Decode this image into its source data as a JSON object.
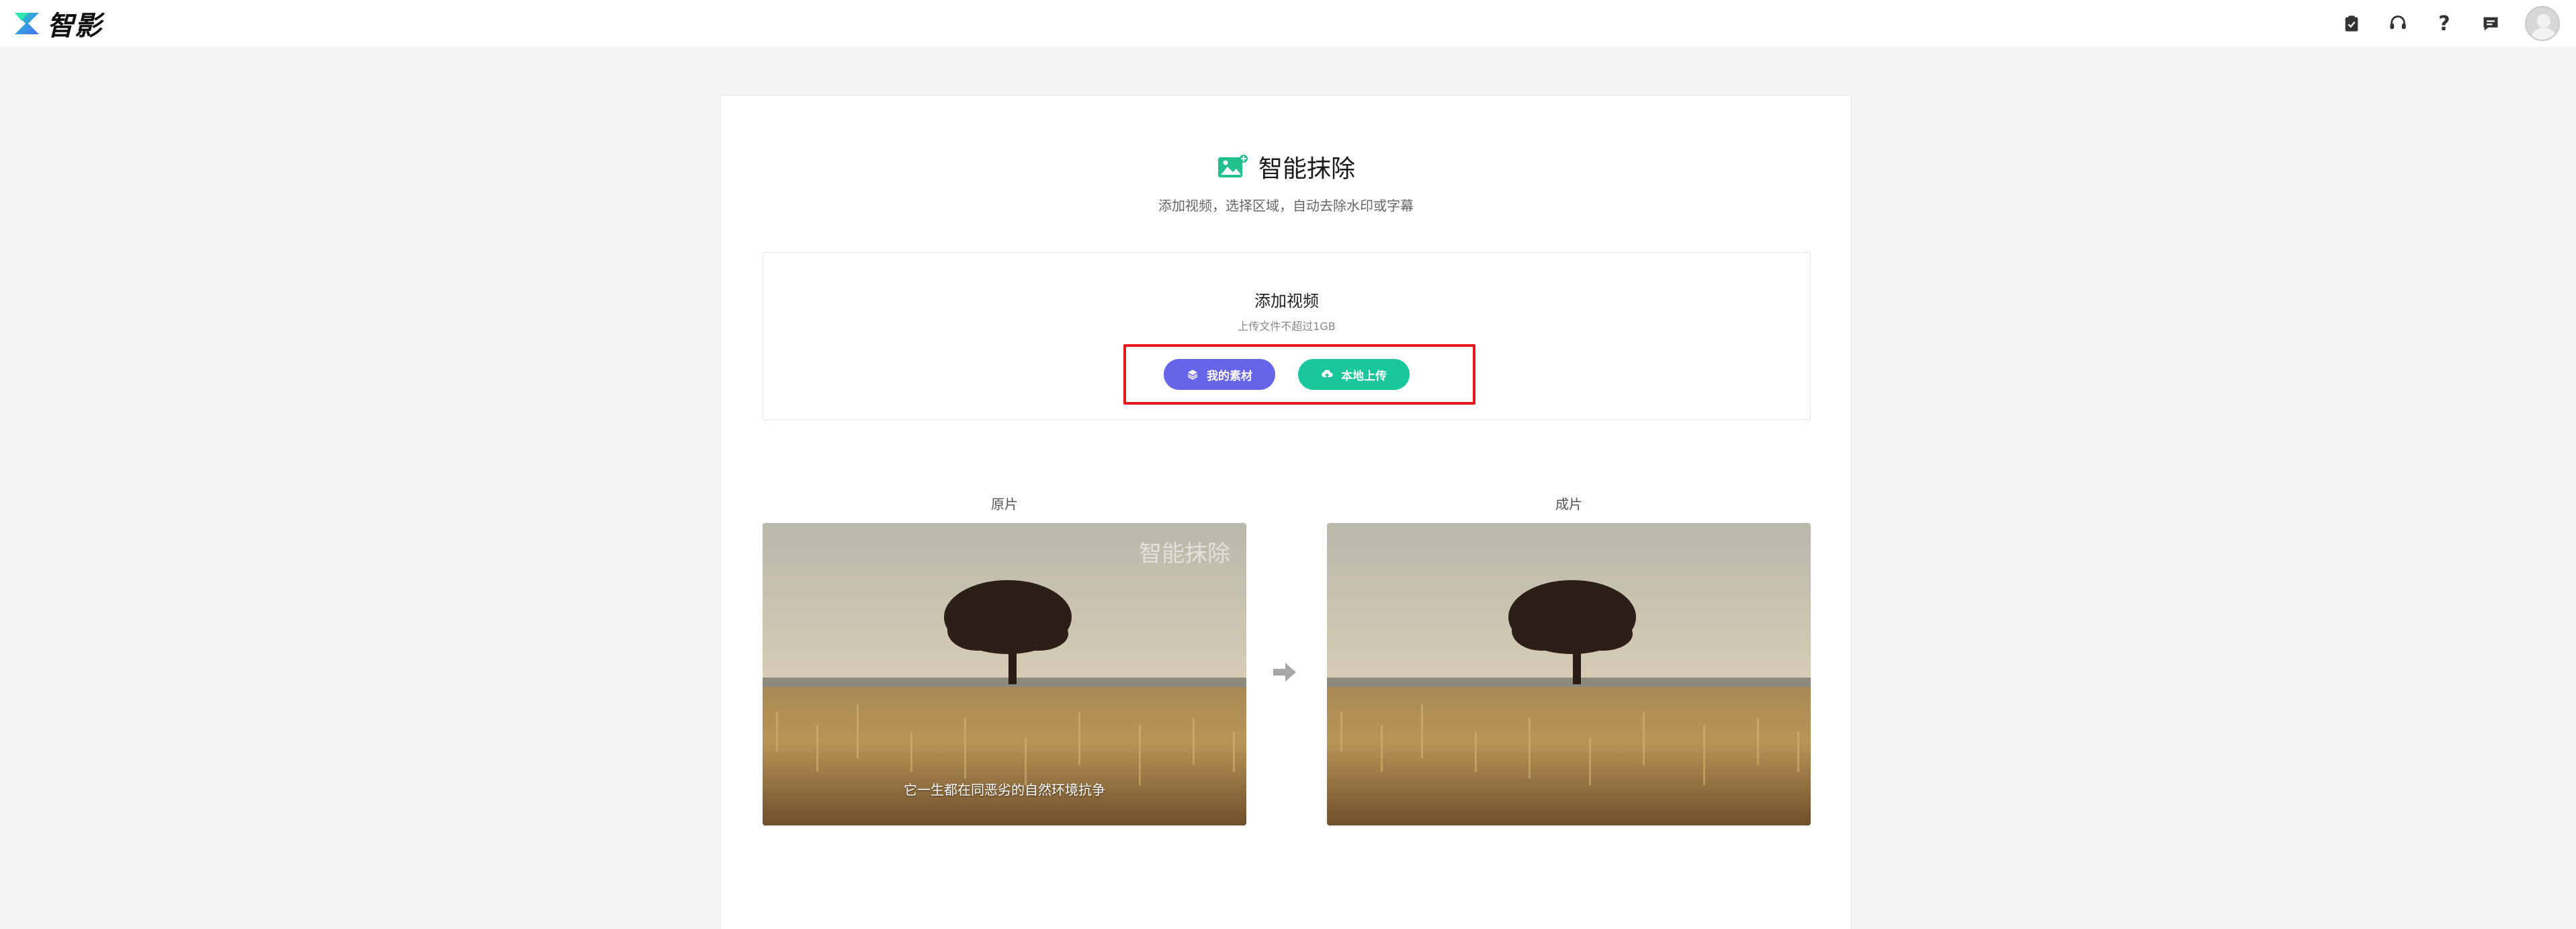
{
  "app": {
    "logo_text": "智影"
  },
  "header": {
    "icons": [
      "clipboard-check-icon",
      "headset-icon",
      "help-icon",
      "message-icon",
      "avatar"
    ],
    "help_glyph": "?"
  },
  "tool": {
    "title": "智能抹除",
    "subtitle": "添加视频，选择区域，自动去除水印或字幕"
  },
  "upload": {
    "title": "添加视频",
    "hint": "上传文件不超过1GB",
    "my_material_label": "我的素材",
    "local_upload_label": "本地上传"
  },
  "preview": {
    "original_label": "原片",
    "result_label": "成片",
    "watermark_text": "智能抹除",
    "caption_text": "它一生都在同恶劣的自然环境抗争"
  },
  "colors": {
    "accent_purple": "#6664e8",
    "accent_green": "#19c79a",
    "highlight_red": "#e8161f"
  }
}
